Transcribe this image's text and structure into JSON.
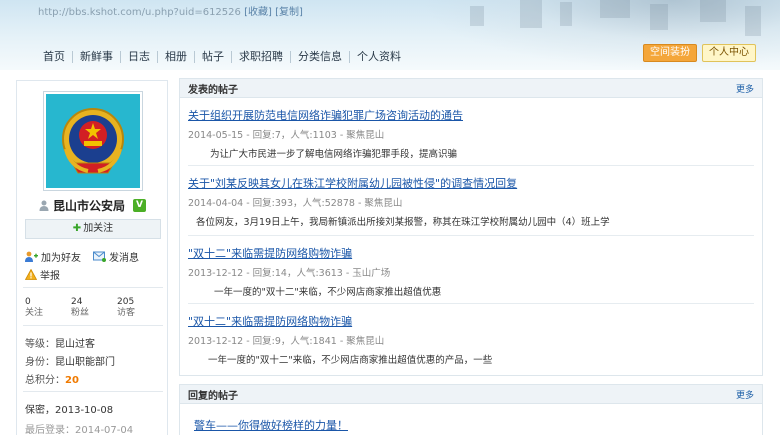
{
  "browser": {
    "url": "http://bbs.kshot.com/u.php?uid=612526",
    "collect_label": "[收藏]",
    "copy_label": "[复制]"
  },
  "nav": {
    "items": [
      "首页",
      "新鲜事",
      "日志",
      "相册",
      "帖子",
      "求职招聘",
      "分类信息",
      "个人资料"
    ]
  },
  "top_buttons": {
    "space_decor": "空间装扮",
    "personal_center": "个人中心"
  },
  "profile": {
    "name": "昆山市公安局",
    "verified_badge": "V",
    "follow_label": "加关注",
    "add_friend_label": "加为好友",
    "send_message_label": "发消息",
    "report_label": "举报",
    "stats": [
      {
        "value": "0",
        "label": "关注"
      },
      {
        "value": "24",
        "label": "粉丝"
      },
      {
        "value": "205",
        "label": "访客"
      }
    ],
    "level_key": "等级：",
    "level_value": "昆山过客",
    "identity_key": "身份：",
    "identity_value": "昆山职能部门",
    "points_key": "总积分：",
    "points_value": "20",
    "privacy_line": "保密，2013-10-08",
    "last_login": "最后登录：2014-07-04"
  },
  "posts_panel": {
    "title": "发表的帖子",
    "more": "更多",
    "posts": [
      {
        "title": "关于组织开展防范电信网络诈骗犯罪广场咨询活动的通告",
        "meta": "2014-05-15 - 回复:7，人气:1103 - 聚焦昆山",
        "excerpt": "为让广大市民进一步了解电信网络诈骗犯罪手段，提高识骗"
      },
      {
        "title": "关于\"刘某反映其女儿在珠江学校附属幼儿园被性侵\"的调查情况回复",
        "meta": "2014-04-04 - 回复:393，人气:52878 - 聚焦昆山",
        "excerpt": "各位网友，3月19日上午，我局新镇派出所接刘某报警，称其在珠江学校附属幼儿园中（4）班上学"
      },
      {
        "title": "\"双十二\"来临需提防网络购物诈骗",
        "meta": "2013-12-12 - 回复:14，人气:3613 - 玉山广场",
        "excerpt": "一年一度的\"双十二\"来临，不少网店商家推出超值优惠"
      },
      {
        "title": "\"双十二\"来临需提防网络购物诈骗",
        "meta": "2013-12-12 - 回复:9，人气:1841 - 聚焦昆山",
        "excerpt": "一年一度的\"双十二\"来临，不少网店商家推出超值优惠的产品，一些"
      }
    ]
  },
  "replies_panel": {
    "title": "回复的帖子",
    "more": "更多",
    "first_title": "警车——你得做好榜样的力量！"
  }
}
